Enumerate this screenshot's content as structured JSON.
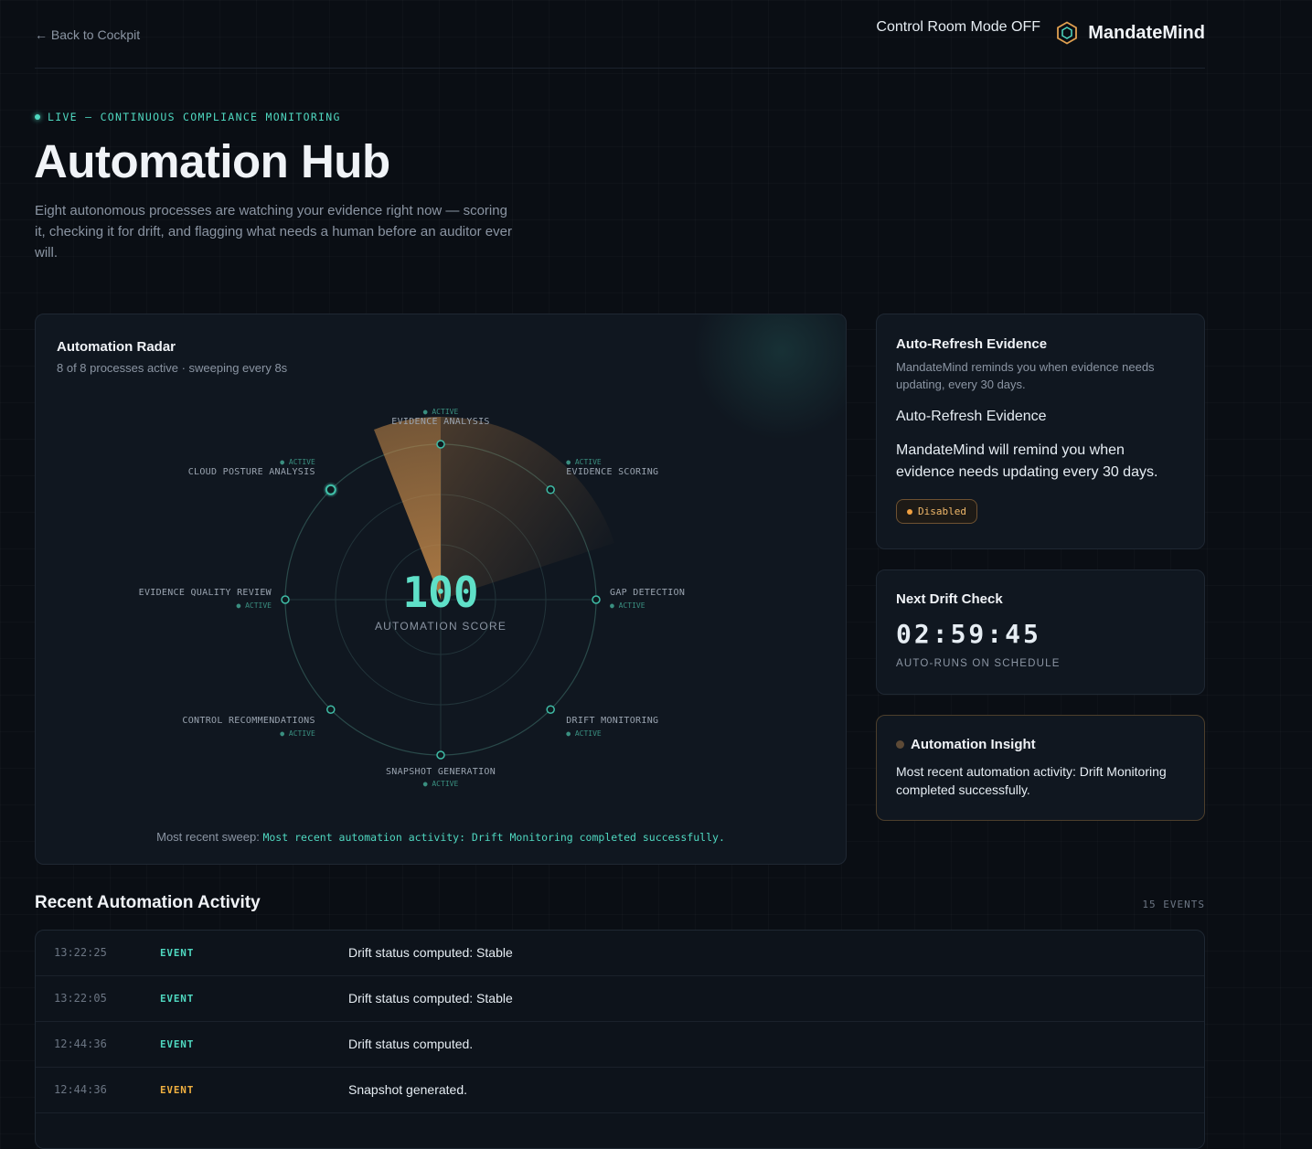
{
  "header": {
    "back_label": "← Back to Cockpit",
    "mode_label": "Control Room Mode OFF",
    "brand": "MandateMind",
    "logo_icon": "hexagon-icon"
  },
  "hero": {
    "live_label": "LIVE — CONTINUOUS COMPLIANCE MONITORING",
    "title": "Automation Hub",
    "description": "Eight autonomous processes are watching your evidence right now — scoring it, checking it for drift, and flagging what needs a human before an auditor ever will."
  },
  "radar": {
    "title": "Automation Radar",
    "subtitle": "8 of 8 processes active · sweeping every 8s",
    "score": "100",
    "score_label": "AUTOMATION SCORE",
    "processes": [
      {
        "name": "EVIDENCE ANALYSIS",
        "status": "● ACTIVE"
      },
      {
        "name": "EVIDENCE SCORING",
        "status": "● ACTIVE"
      },
      {
        "name": "GAP DETECTION",
        "status": "● ACTIVE"
      },
      {
        "name": "DRIFT MONITORING",
        "status": "● ACTIVE"
      },
      {
        "name": "SNAPSHOT GENERATION",
        "status": "● ACTIVE"
      },
      {
        "name": "CONTROL RECOMMENDATIONS",
        "status": "● ACTIVE"
      },
      {
        "name": "EVIDENCE QUALITY REVIEW",
        "status": "● ACTIVE"
      },
      {
        "name": "CLOUD POSTURE ANALYSIS",
        "status": "● ACTIVE"
      }
    ],
    "sweep_prefix": "Most recent sweep:",
    "sweep_text": "Most recent automation activity: Drift Monitoring completed successfully."
  },
  "auto_refresh": {
    "title": "Auto-Refresh Evidence",
    "subtitle": "MandateMind reminds you when evidence needs updating, every 30 days.",
    "heading": "Auto-Refresh Evidence",
    "description": "MandateMind will remind you when evidence needs updating every 30 days.",
    "status": "Disabled"
  },
  "drift_check": {
    "title": "Next Drift Check",
    "countdown": "02:59:45",
    "caption": "AUTO-RUNS ON SCHEDULE"
  },
  "insight": {
    "title": "Automation Insight",
    "body": "Most recent automation activity: Drift Monitoring completed successfully."
  },
  "activity": {
    "title": "Recent Automation Activity",
    "count": "15 EVENTS",
    "rows": [
      {
        "time": "13:22:25",
        "type": "EVENT",
        "message": "Drift status computed: Stable",
        "color": "#4fd8c0"
      },
      {
        "time": "13:22:05",
        "type": "EVENT",
        "message": "Drift status computed: Stable",
        "color": "#4fd8c0"
      },
      {
        "time": "12:44:36",
        "type": "EVENT",
        "message": "Drift status computed.",
        "color": "#4fd8c0"
      },
      {
        "time": "12:44:36",
        "type": "EVENT",
        "message": "Snapshot generated.",
        "color": "#f0b040"
      },
      {
        "time": "",
        "type": "",
        "message": "",
        "color": "#4fd8c0"
      }
    ]
  },
  "colors": {
    "accent": "#4fd8c0",
    "warning": "#f0b040",
    "background": "#0a0e14"
  }
}
